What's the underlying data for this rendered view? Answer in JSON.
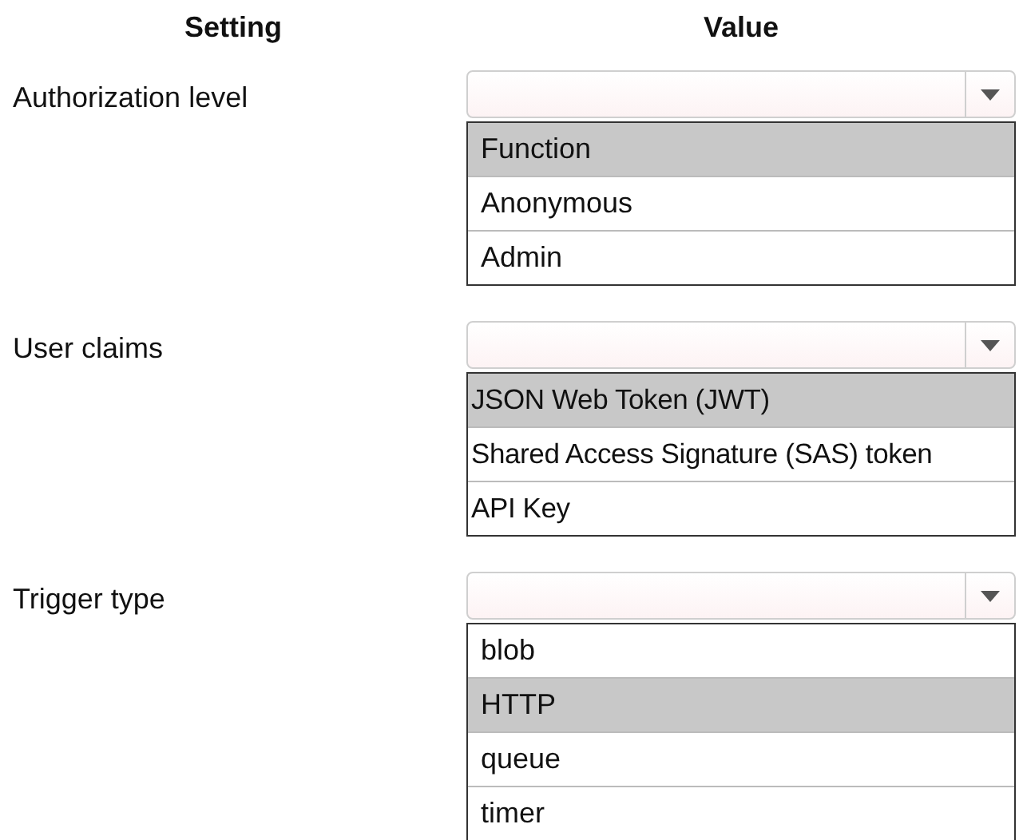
{
  "headers": {
    "setting": "Setting",
    "value": "Value"
  },
  "rows": [
    {
      "label": "Authorization level",
      "options": [
        {
          "label": "Function",
          "selected": true
        },
        {
          "label": "Anonymous",
          "selected": false
        },
        {
          "label": "Admin",
          "selected": false
        }
      ]
    },
    {
      "label": "User claims",
      "options": [
        {
          "label": "JSON Web Token (JWT)",
          "selected": true
        },
        {
          "label": "Shared Access Signature (SAS) token",
          "selected": false
        },
        {
          "label": "API Key",
          "selected": false
        }
      ]
    },
    {
      "label": "Trigger type",
      "options": [
        {
          "label": "blob",
          "selected": false
        },
        {
          "label": "HTTP",
          "selected": true
        },
        {
          "label": "queue",
          "selected": false
        },
        {
          "label": "timer",
          "selected": false
        }
      ]
    }
  ]
}
